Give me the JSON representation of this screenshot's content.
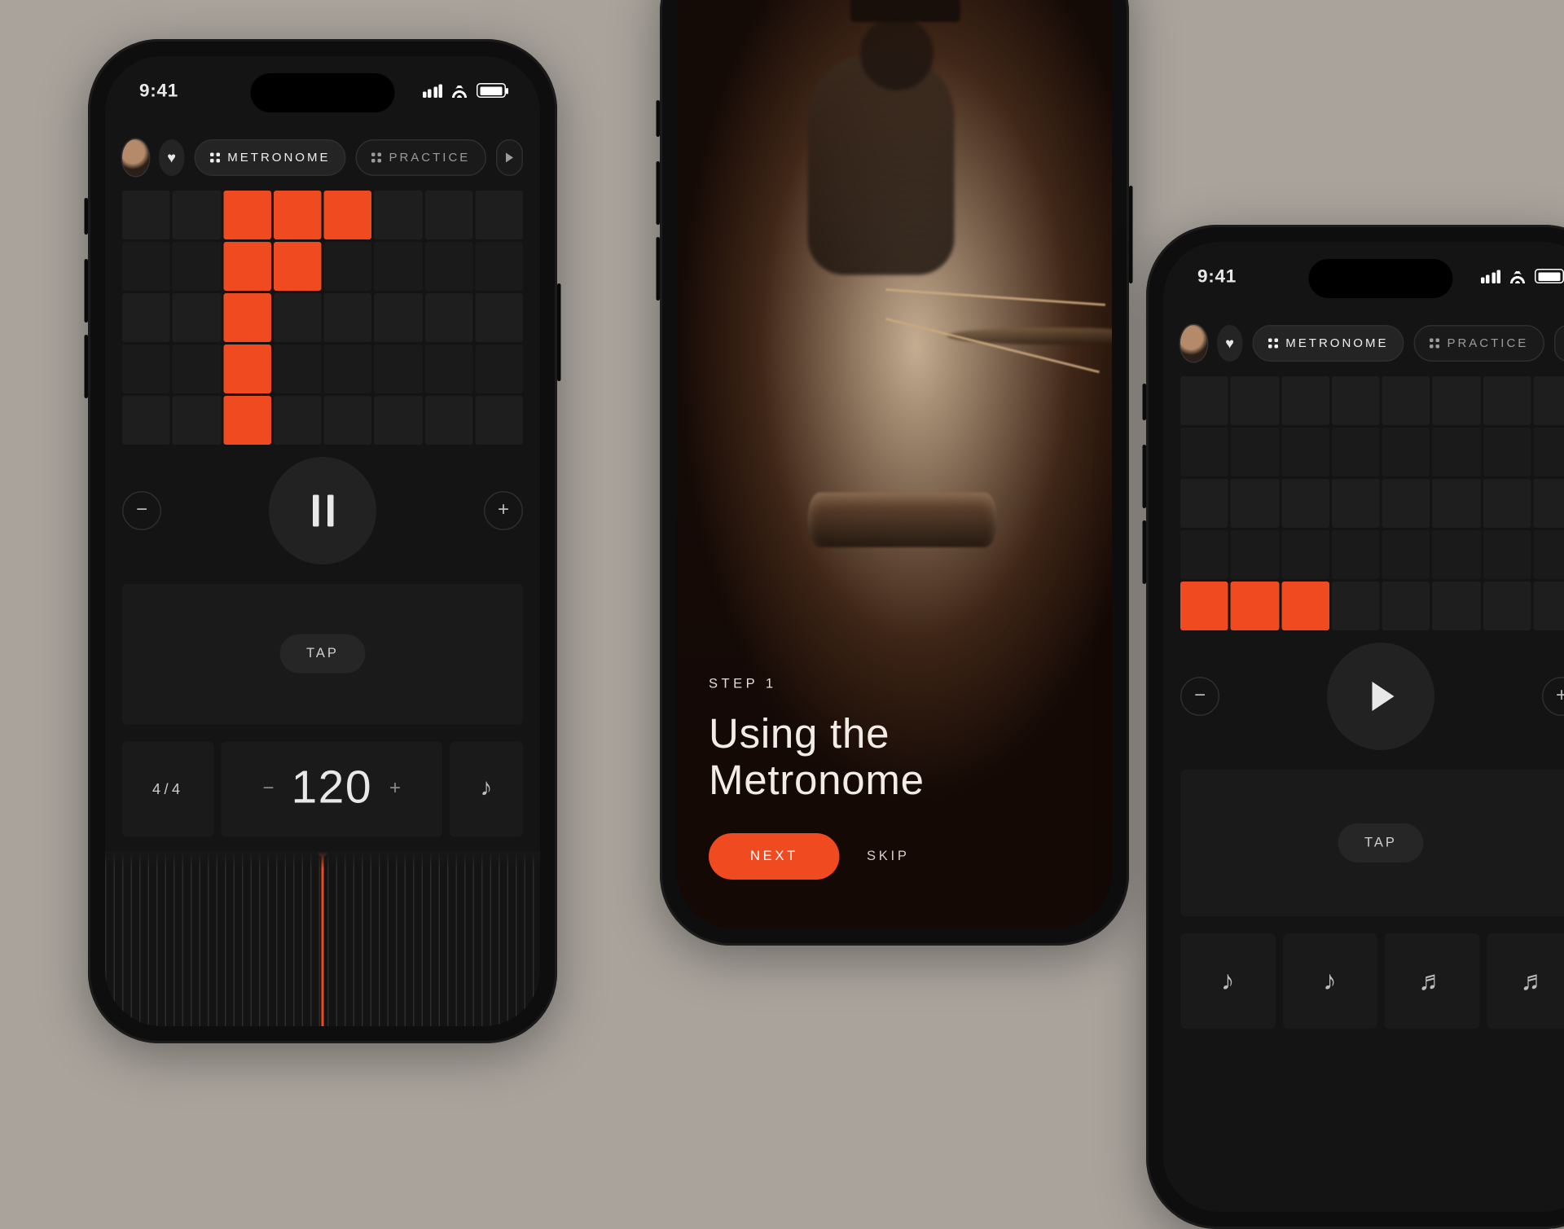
{
  "status": {
    "time": "9:41"
  },
  "nav": {
    "tabs": [
      {
        "label": "METRONOME",
        "active": true
      },
      {
        "label": "PRACTICE",
        "active": false
      }
    ]
  },
  "p1": {
    "grid": {
      "cols": 8,
      "rows": 5,
      "active": [
        [
          0,
          2
        ],
        [
          0,
          3
        ],
        [
          0,
          4
        ],
        [
          1,
          2
        ],
        [
          1,
          3
        ],
        [
          2,
          2
        ],
        [
          3,
          2
        ],
        [
          4,
          2
        ]
      ]
    },
    "tap_label": "TAP",
    "time_signature": "4/4",
    "bpm": 120,
    "subdivision_glyph": "♪"
  },
  "onboarding": {
    "step": "STEP 1",
    "title_line1": "Using the",
    "title_line2": "Metronome",
    "next": "NEXT",
    "skip": "SKIP"
  },
  "p3": {
    "grid": {
      "cols": 8,
      "rows": 5,
      "active": [
        [
          4,
          0
        ],
        [
          4,
          1
        ],
        [
          4,
          2
        ]
      ]
    },
    "tap_label": "TAP",
    "notes": [
      "♪",
      "♪",
      "♬",
      "♬"
    ]
  },
  "colors": {
    "accent": "#f04a21"
  }
}
